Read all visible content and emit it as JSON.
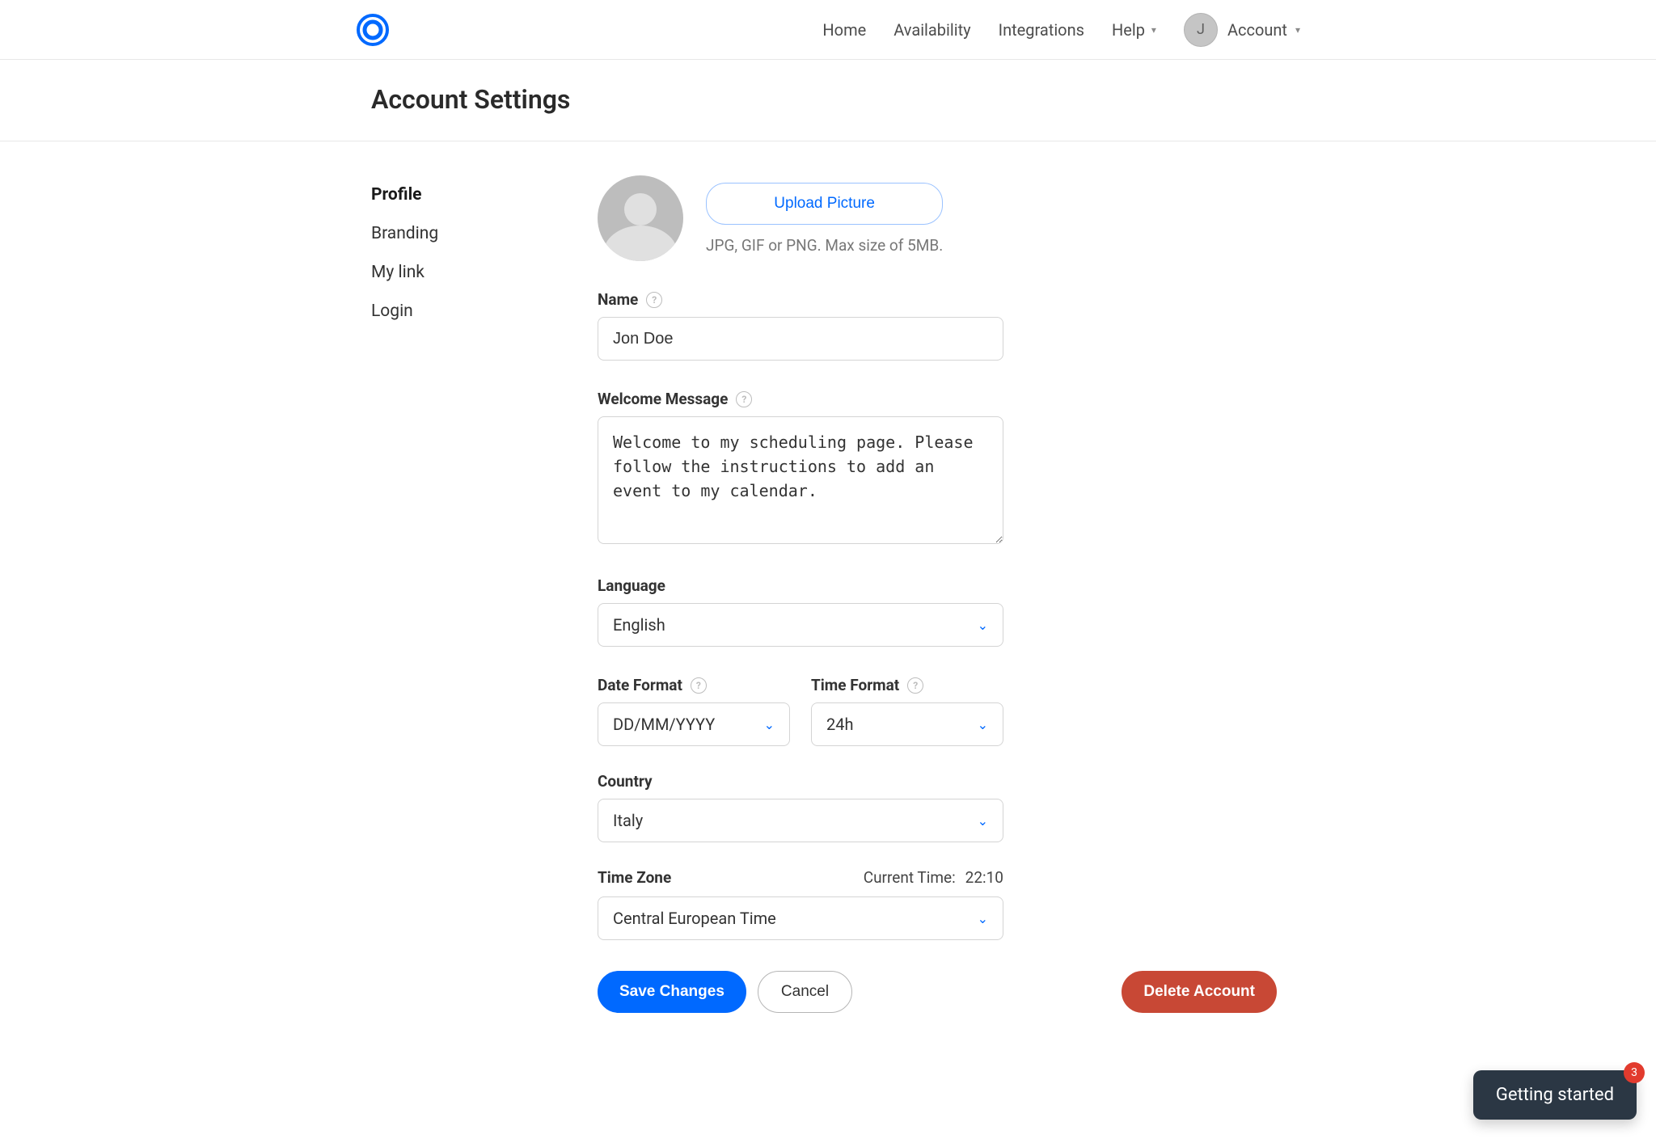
{
  "header": {
    "nav": {
      "home": "Home",
      "availability": "Availability",
      "integrations": "Integrations",
      "help": "Help",
      "account": "Account"
    },
    "avatar_initial": "J"
  },
  "page": {
    "title": "Account Settings"
  },
  "sidebar": {
    "items": {
      "profile": "Profile",
      "branding": "Branding",
      "mylink": "My link",
      "login": "Login"
    }
  },
  "profile": {
    "picture": {
      "upload_label": "Upload Picture",
      "hint": "JPG, GIF or PNG. Max size of 5MB."
    },
    "name": {
      "label": "Name",
      "value": "Jon Doe"
    },
    "welcome": {
      "label": "Welcome Message",
      "value": "Welcome to my scheduling page. Please follow the instructions to add an event to my calendar."
    },
    "language": {
      "label": "Language",
      "value": "English"
    },
    "date_format": {
      "label": "Date Format",
      "value": "DD/MM/YYYY"
    },
    "time_format": {
      "label": "Time Format",
      "value": "24h"
    },
    "country": {
      "label": "Country",
      "value": "Italy"
    },
    "timezone": {
      "label": "Time Zone",
      "value": "Central European Time",
      "current_time_label": "Current Time:",
      "current_time_value": "22:10"
    }
  },
  "actions": {
    "save": "Save Changes",
    "cancel": "Cancel",
    "delete": "Delete Account"
  },
  "widget": {
    "label": "Getting started",
    "badge": "3"
  }
}
